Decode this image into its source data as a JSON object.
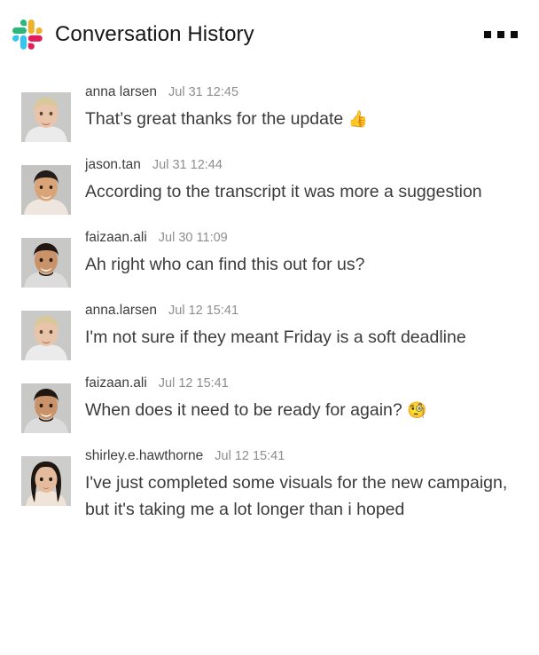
{
  "header": {
    "title": "Conversation History",
    "logo_icon": "slack-logo",
    "overflow_icon": "more-horizontal-icon",
    "logo_colors": {
      "cyan": "#36C5F0",
      "green": "#2EB67D",
      "crimson": "#E01E5A",
      "yellow": "#ECB22E"
    },
    "title_color": "#161616"
  },
  "colors": {
    "background": "#ffffff",
    "author": "#3d3d3d",
    "timestamp": "#8e8e8e",
    "message_text": "#3b3b3b",
    "avatar_placeholder": "#c9c9c7"
  },
  "messages": [
    {
      "author": "anna larsen",
      "timestamp": "Jul 31 12:45",
      "text": "That’s great thanks for the update ",
      "emoji": "👍",
      "avatar": "avatar-anna-larsen",
      "avatar_hair": "#d8c89a",
      "avatar_skin": "#e8c4ab",
      "avatar_bg": "#c9c9c7",
      "avatar_clothes": "#ebebeb"
    },
    {
      "author": "jason.tan",
      "timestamp": "Jul 31 12:44",
      "text": "According to the transcript it was more a suggestion",
      "emoji": "",
      "avatar": "avatar-jason-tan",
      "avatar_hair": "#241c18",
      "avatar_skin": "#d9a478",
      "avatar_bg": "#c4c4c2",
      "avatar_clothes": "#efe7df"
    },
    {
      "author": "faizaan.ali",
      "timestamp": "Jul 30 11:09",
      "text": "Ah right who can find this out for us?",
      "emoji": "",
      "avatar": "avatar-faizaan-ali",
      "avatar_hair": "#201713",
      "avatar_skin": "#c99268",
      "avatar_bg": "#c8c8c6",
      "avatar_clothes": "#dcdcdc"
    },
    {
      "author": "anna.larsen",
      "timestamp": "Jul 12 15:41",
      "text": "I'm not sure if they meant Friday is a soft deadline",
      "emoji": "",
      "avatar": "avatar-anna-larsen",
      "avatar_hair": "#d8c89a",
      "avatar_skin": "#e8c4ab",
      "avatar_bg": "#c9c9c7",
      "avatar_clothes": "#ebebeb"
    },
    {
      "author": "faizaan.ali",
      "timestamp": "Jul 12 15:41",
      "text": "When does it need to be ready for again? ",
      "emoji": "🧐",
      "avatar": "avatar-faizaan-ali",
      "avatar_hair": "#201713",
      "avatar_skin": "#c99268",
      "avatar_bg": "#c8c8c6",
      "avatar_clothes": "#dcdcdc"
    },
    {
      "author": "shirley.e.hawthorne",
      "timestamp": "Jul 12 15:41",
      "text": "I've just completed some visuals for the new campaign, but it's taking me a lot longer than i hoped",
      "emoji": "",
      "avatar": "avatar-shirley-hawthorne",
      "avatar_hair": "#1d1613",
      "avatar_skin": "#e4bb9c",
      "avatar_bg": "#cdcdcb",
      "avatar_clothes": "#f0e3d8"
    }
  ]
}
